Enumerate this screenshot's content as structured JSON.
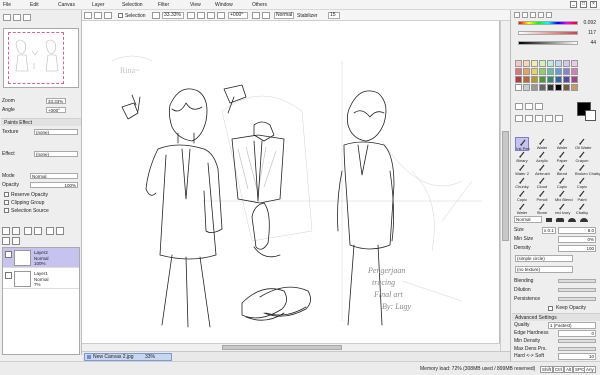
{
  "menu": {
    "items": [
      "File",
      "Edit",
      "Canvas",
      "Layer",
      "Selection",
      "Filter",
      "View",
      "Window",
      "Others"
    ],
    "window_controls": [
      "_",
      "□",
      "×"
    ]
  },
  "toolbar": {
    "selection_label": "Selection",
    "zoom": "33.33%",
    "rotation": "+000°",
    "blend": "Normal",
    "stabilizer_label": "Stabilizer",
    "stabilizer": "15"
  },
  "left_panel": {
    "zoom_label": "Zoom",
    "zoom_value": "33.33%",
    "angle_label": "Angle",
    "angle_value": "+000°",
    "paint_effect_header": "Paints Effect",
    "texture_label": "Texture",
    "texture_value": "(none)",
    "effect_label": "Effect",
    "effect_value": "(none)",
    "mode_label": "Mode",
    "mode_value": "Normal",
    "opacity_label": "Opacity",
    "opacity_value": "100%",
    "reserve_opacity": "Reserve Opacity",
    "clipping_group": "Clipping Group",
    "selection_source": "Selection Source",
    "layers": [
      {
        "name": "Layer2",
        "mode": "Normal",
        "opacity": "100%",
        "selected": true
      },
      {
        "name": "Layer1",
        "mode": "Normal",
        "opacity": "7%",
        "selected": false
      }
    ]
  },
  "canvas": {
    "handwriting": [
      "Pengerjaan",
      "tracing",
      "Final art",
      "By: Lugy"
    ]
  },
  "tabs": {
    "active_tab": "New Canvas 2.jpg",
    "active_tab_zoom": "33%"
  },
  "status": {
    "memory": "Memory load: 72% (308MB used / 899MB reserved)",
    "keys": [
      "Shift",
      "Ctrl",
      "Alt",
      "SPC",
      "Any"
    ]
  },
  "right_panel": {
    "color_values": [
      "0.092",
      "117",
      "44"
    ],
    "swatch_colors": [
      "#f4c6c6",
      "#f7d7b5",
      "#f5edb0",
      "#d7f0b7",
      "#bfe8de",
      "#bcd8f2",
      "#cfc8ef",
      "#efc8e3",
      "#e07373",
      "#eba064",
      "#e8d35f",
      "#8fcf6b",
      "#5fbfa8",
      "#5e9fdc",
      "#8d7fdb",
      "#d77cbd",
      "#b53b3b",
      "#b96a2f",
      "#b39a29",
      "#4f9438",
      "#2e8a77",
      "#2f68a8",
      "#5848a8",
      "#a2458a",
      "#ffffff",
      "#cccccc",
      "#999999",
      "#666666",
      "#333333",
      "#000000",
      "#7a5a3a",
      "#c79a6b"
    ],
    "tools": [
      {
        "name": "Ink Pen",
        "sub": "",
        "selected": true
      },
      {
        "name": "Water",
        "sub": "",
        "selected": false
      },
      {
        "name": "Water",
        "sub": "",
        "selected": false
      },
      {
        "name": "Oil Water",
        "sub": "",
        "selected": false
      },
      {
        "name": "Binary",
        "sub": "",
        "selected": false
      },
      {
        "name": "Acrylic",
        "sub": "",
        "selected": false
      },
      {
        "name": "Paper",
        "sub": "",
        "selected": false
      },
      {
        "name": "Crayon",
        "sub": "",
        "selected": false
      },
      {
        "name": "Water 2",
        "sub": "",
        "selected": false
      },
      {
        "name": "Airbrush",
        "sub": "",
        "selected": false
      },
      {
        "name": "Blend",
        "sub": "",
        "selected": false
      },
      {
        "name": "Broken Chalky",
        "sub": "",
        "selected": false
      },
      {
        "name": "Chunky",
        "sub": "",
        "selected": false
      },
      {
        "name": "Cloud",
        "sub": "",
        "selected": false
      },
      {
        "name": "Copic",
        "sub": "",
        "selected": false
      },
      {
        "name": "Copic",
        "sub": "",
        "selected": false
      },
      {
        "name": "Copic",
        "sub": "",
        "selected": false
      },
      {
        "name": "Pencil",
        "sub": "",
        "selected": false
      },
      {
        "name": "Mix Blend",
        "sub": "",
        "selected": false
      },
      {
        "name": "Paint",
        "sub": "",
        "selected": false
      },
      {
        "name": "Water",
        "sub": "",
        "selected": false
      },
      {
        "name": "Stone",
        "sub": "",
        "selected": false
      },
      {
        "name": "red ivory",
        "sub": "",
        "selected": false
      },
      {
        "name": "Chalky",
        "sub": "",
        "selected": false
      }
    ],
    "blend_mode": "Normal",
    "size_label": "Size",
    "size_multiplier": "x 0.1",
    "size_value": "8.0",
    "min_size_label": "Min Size",
    "min_size_value": "0%",
    "density_label": "Density",
    "density_value": "100",
    "shape_value": "(simple circle)",
    "texture_value": "(no texture)",
    "blending_label": "Blending",
    "dilution_label": "Dilution",
    "persistence_label": "Persistence",
    "keep_opacity": "Keep Opacity",
    "advanced_header": "Advanced Settings",
    "quality_label": "Quality",
    "quality_value": "1 (Fastest)",
    "edge_hardness_label": "Edge Hardness",
    "edge_hardness_value": "0",
    "min_density_label": "Min Density",
    "max_dens_prs_label": "Max Dens Prs.",
    "hard_soft_label": "Hard <-> Soft",
    "hard_soft_value": "10"
  }
}
